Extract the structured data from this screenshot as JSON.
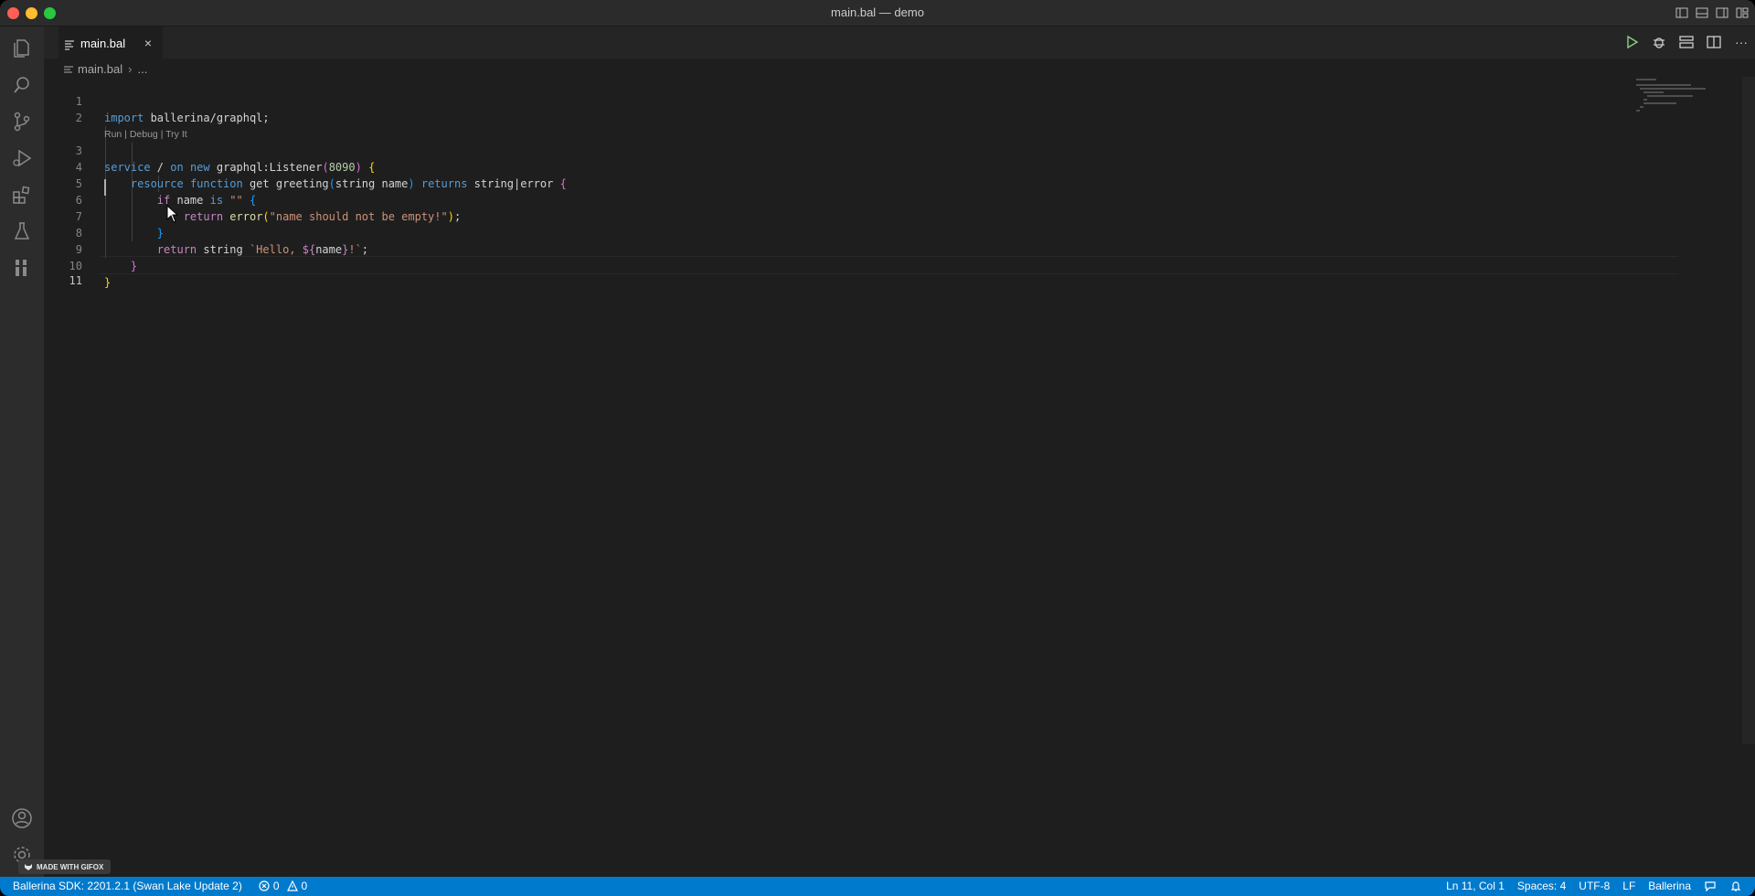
{
  "window": {
    "title": "main.bal — demo"
  },
  "tabs": [
    {
      "label": "main.bal",
      "close_glyph": "×"
    }
  ],
  "editor_actions": {
    "more_glyph": "···"
  },
  "breadcrumb": {
    "file": "main.bal",
    "ellipsis": "..."
  },
  "codelens": {
    "run": "Run",
    "sep1": " | ",
    "debug": "Debug",
    "sep2": " | ",
    "try": "Try It"
  },
  "code": {
    "line_numbers": [
      "1",
      "2",
      "3",
      "4",
      "5",
      "6",
      "7",
      "8",
      "9",
      "10",
      "11"
    ],
    "l1": {
      "kw": "import",
      "rest": " ballerina/graphql;"
    },
    "l3": {
      "service": "service",
      "slash": " / ",
      "on": "on",
      "sp1": " ",
      "new": "new",
      "sp2": " ",
      "listener": "graphql:Listener",
      "p1": "(",
      "port": "8090",
      "p2": ")",
      "sp3": " ",
      "brace": "{"
    },
    "l4": {
      "indent": "    ",
      "resource": "resource",
      "sp1": " ",
      "function": "function",
      "mid": " get greeting",
      "p1": "(",
      "params": "string name",
      "p2": ")",
      "sp2": " ",
      "returns": "returns",
      "ret": " string|error ",
      "brace": "{"
    },
    "l5": {
      "indent": "        ",
      "if": "if",
      "mid": " name ",
      "is": "is",
      "sp": " ",
      "str": "\"\"",
      "sp2": " ",
      "brace": "{"
    },
    "l6": {
      "indent": "            ",
      "return": "return",
      "sp": " ",
      "error": "error",
      "p1": "(",
      "str": "\"name should not be empty!\"",
      "p2": ")",
      "semi": ";"
    },
    "l7": {
      "indent": "        ",
      "brace": "}"
    },
    "l8": {
      "indent": "        ",
      "return": "return",
      "mid": " string ",
      "t1": "`Hello, ",
      "interp_open": "${",
      "interp_var": "name",
      "interp_close": "}",
      "t2": "!`",
      "semi": ";"
    },
    "l9": {
      "indent": "    ",
      "brace": "}"
    },
    "l10": {
      "brace": "}"
    }
  },
  "status_bar": {
    "sdk": "Ballerina SDK: 2201.2.1 (Swan Lake Update 2)",
    "errors": "0",
    "warnings": "0",
    "cursor": "Ln 11, Col 1",
    "spaces": "Spaces: 4",
    "encoding": "UTF-8",
    "eol": "LF",
    "language": "Ballerina"
  },
  "badge": {
    "gifox": "MADE WITH GIFOX"
  },
  "colors": {
    "statusbar_bg": "#007acc",
    "keyword": "#569cd6",
    "control": "#c586c0",
    "string": "#ce9178",
    "number": "#b5cea8",
    "function": "#dcdcaa"
  },
  "icons": [
    "files-icon",
    "search-icon",
    "source-control-icon",
    "run-debug-icon",
    "extensions-icon",
    "testing-icon",
    "ballerina-icon",
    "account-icon",
    "settings-gear-icon",
    "play-icon",
    "debug-icon",
    "layout-icon",
    "split-editor-icon",
    "more-icon",
    "error-icon",
    "warning-icon",
    "feedback-icon",
    "bell-icon"
  ]
}
